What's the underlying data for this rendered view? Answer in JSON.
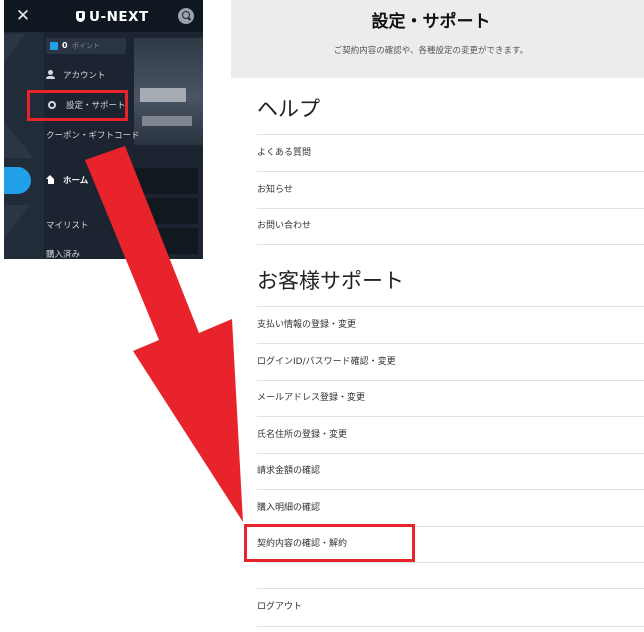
{
  "menu": {
    "logo_text": "U-NEXT",
    "points_value": "0",
    "points_unit": "ポイント",
    "items": {
      "account": "アカウント",
      "settings": "設定・サポート",
      "coupon": "クーポン・ギフトコード",
      "home": "ホーム",
      "mylist": "マイリスト",
      "purchased": "購入済み"
    }
  },
  "settings": {
    "title": "設定・サポート",
    "subtitle": "ご契約内容の確認や、各種設定の変更ができます。",
    "help_title": "ヘルプ",
    "help_items": [
      "よくある質問",
      "お知らせ",
      "お問い合わせ"
    ],
    "support_title": "お客様サポート",
    "support_items": [
      "支払い情報の登録・変更",
      "ログインID/パスワード確認・変更",
      "メールアドレス登録・変更",
      "氏名住所の登録・変更",
      "請求金額の確認",
      "購入明細の確認",
      "契約内容の確認・解約"
    ],
    "logout": "ログアウト"
  },
  "colors": {
    "highlight": "#e8232b",
    "menu_bg": "#1b2430",
    "accent": "#1fa0e8"
  },
  "icons": [
    "close-icon",
    "search-icon",
    "account-icon",
    "gear-icon",
    "home-icon"
  ]
}
